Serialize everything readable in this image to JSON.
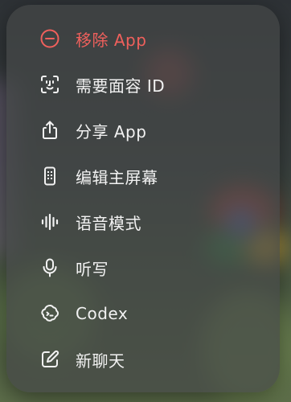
{
  "menu": {
    "items": [
      {
        "label": "移除 App",
        "icon": "minus-circle-icon",
        "destructive": true,
        "color": "#f0605c"
      },
      {
        "label": "需要面容 ID",
        "icon": "face-id-icon"
      },
      {
        "label": "分享 App",
        "icon": "share-icon"
      },
      {
        "label": "编辑主屏幕",
        "icon": "phone-edit-icon"
      },
      {
        "label": "语音模式",
        "icon": "waveform-icon"
      },
      {
        "label": "听写",
        "icon": "microphone-icon"
      },
      {
        "label": "Codex",
        "icon": "codex-icon"
      },
      {
        "label": "新聊天",
        "icon": "compose-icon"
      }
    ]
  }
}
